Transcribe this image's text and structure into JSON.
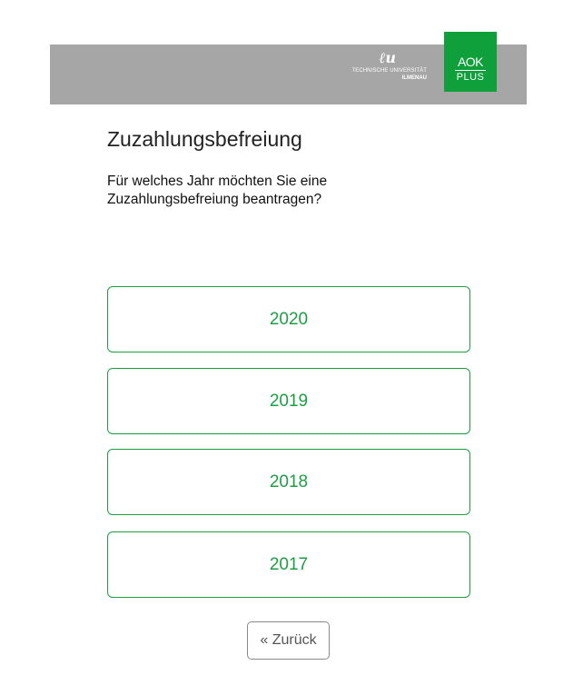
{
  "header": {
    "tu_logo": {
      "mark": "ℓu",
      "line1": "TECHNISCHE UNIVERSITÄT",
      "line2": "ILMENAU"
    },
    "aok_logo": {
      "top": "AOK",
      "bottom": "PLUS",
      "color": "#0f9f3b"
    },
    "background": "#a6a6a6"
  },
  "page": {
    "title": "Zuzahlungsbefreiung",
    "question": "Für welches Jahr möchten Sie eine Zuzahlungsbefreiung beantragen?"
  },
  "years": [
    "2020",
    "2019",
    "2018",
    "2017"
  ],
  "back_label": "« Zurück",
  "colors": {
    "accent": "#1e9e43",
    "back_border": "#8a8a8a"
  }
}
